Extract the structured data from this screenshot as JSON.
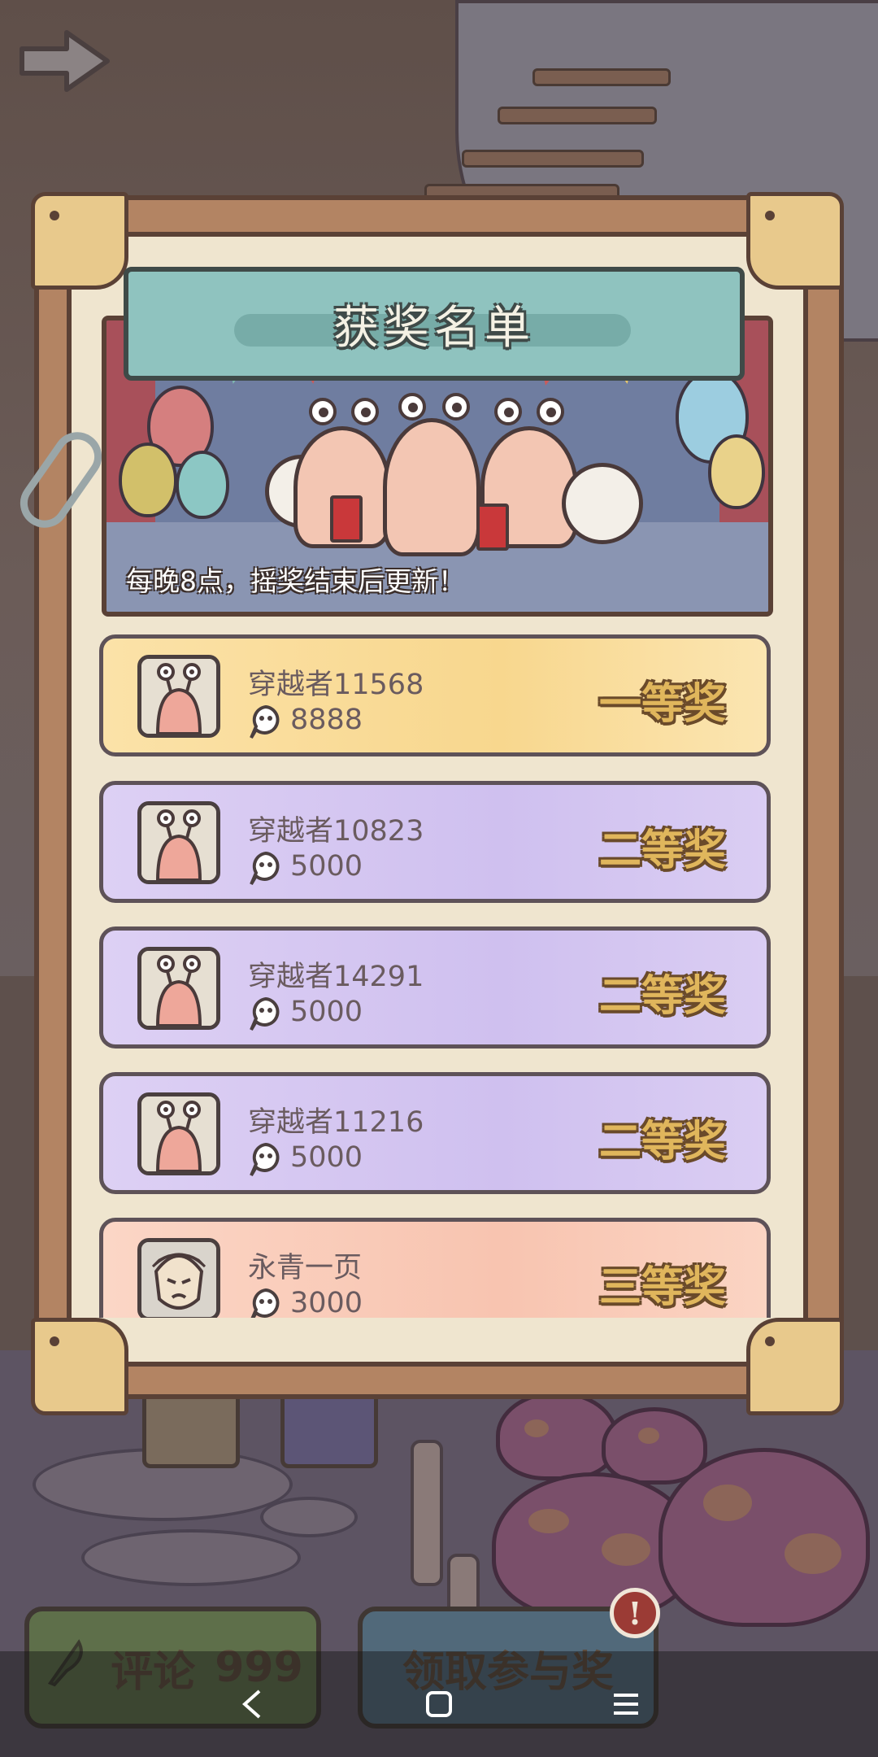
{
  "title": "获奖名单",
  "notice": "每晚8点，摇奖结束后更新！",
  "winners": [
    {
      "name": "穿越者11568",
      "amount": "8888",
      "prize": "一等奖",
      "tier": "gold",
      "avatar": "snail-avatar-icon"
    },
    {
      "name": "穿越者10823",
      "amount": "5000",
      "prize": "二等奖",
      "tier": "purple",
      "avatar": "snail-avatar-icon"
    },
    {
      "name": "穿越者14291",
      "amount": "5000",
      "prize": "二等奖",
      "tier": "purple",
      "avatar": "snail-avatar-icon"
    },
    {
      "name": "穿越者11216",
      "amount": "5000",
      "prize": "二等奖",
      "tier": "purple",
      "avatar": "snail-avatar-icon"
    },
    {
      "name": "永青一页",
      "amount": "3000",
      "prize": "三等奖",
      "tier": "peach",
      "avatar": "warrior-avatar-icon"
    }
  ],
  "bottom_buttons": {
    "comment_label": "评论",
    "comment_count": "999",
    "claim_label": "领取参与奖",
    "claim_badge": "!"
  },
  "icons": {
    "currency": "tadpole-coin-icon",
    "next": "arrow-right-icon",
    "comment": "quill-icon"
  },
  "colors": {
    "gold_row": "#f8d78e",
    "purple_row": "#cfc0ef",
    "peach_row": "#f8c4b0",
    "title_plate": "#8fc3bf",
    "prize_text": "#e0b65c"
  }
}
